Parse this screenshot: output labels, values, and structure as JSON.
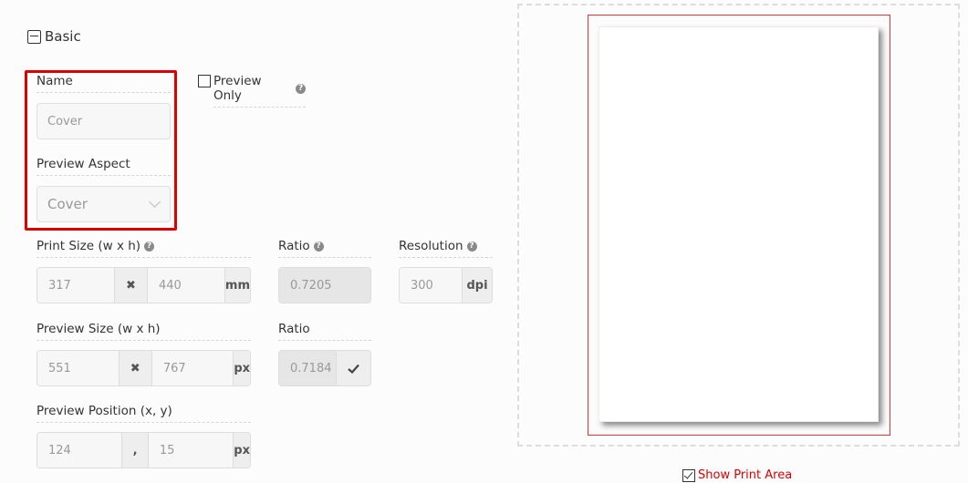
{
  "section": {
    "title": "Basic"
  },
  "name": {
    "label": "Name",
    "value": "Cover"
  },
  "preview_only": {
    "label": "Preview Only",
    "checked": false
  },
  "preview_aspect": {
    "label": "Preview Aspect",
    "value": "Cover"
  },
  "print_size": {
    "label": "Print Size (w x h)",
    "width": "317",
    "height": "440",
    "separator": "✖",
    "unit": "mm"
  },
  "print_ratio": {
    "label": "Ratio",
    "value": "0.7205"
  },
  "resolution": {
    "label": "Resolution",
    "value": "300",
    "unit": "dpi"
  },
  "preview_size": {
    "label": "Preview Size (w x h)",
    "width": "551",
    "height": "767",
    "separator": "✖",
    "unit": "px"
  },
  "preview_ratio": {
    "label": "Ratio",
    "value": "0.7184",
    "confirm_icon": "check-icon"
  },
  "preview_position": {
    "label": "Preview Position (x, y)",
    "x": "124",
    "y": "15",
    "separator": ",",
    "unit": "px"
  },
  "show_print_area": {
    "label": "Show Print Area",
    "checked": true
  },
  "help_glyph": "?",
  "colors": {
    "highlight": "#e00000",
    "print_area": "#e33333",
    "link_red": "#dd0000"
  }
}
